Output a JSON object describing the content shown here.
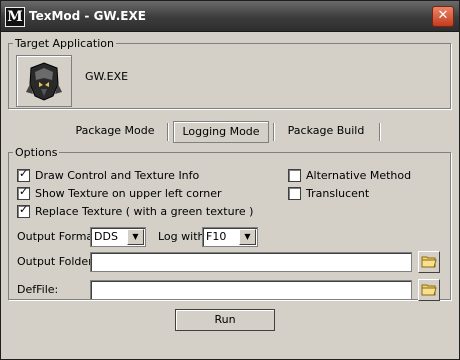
{
  "window": {
    "title": "TexMod - GW.EXE",
    "icon_glyph": "M",
    "close_glyph": "✕"
  },
  "target": {
    "legend": "Target Application",
    "exe_name": "GW.EXE",
    "exe_icon": "helmet-icon"
  },
  "tabs": [
    {
      "label": "Package Mode",
      "active": false
    },
    {
      "label": "Logging Mode",
      "active": true
    },
    {
      "label": "Package Build",
      "active": false
    }
  ],
  "options": {
    "legend": "Options",
    "draw_control": {
      "label": "Draw Control and Texture Info",
      "checked": true
    },
    "show_texture": {
      "label": "Show Texture on upper left corner",
      "checked": true
    },
    "replace_texture": {
      "label": "Replace Texture ( with a green texture )",
      "checked": true
    },
    "alternative_method": {
      "label": "Alternative Method",
      "checked": false
    },
    "translucent": {
      "label": "Translucent",
      "checked": false
    },
    "output_format_label": "Output Format:",
    "output_format_value": "DDS",
    "log_with_label": "Log with",
    "log_with_value": "F10",
    "output_folder_label": "Output Folder:",
    "output_folder_value": "",
    "deffile_label": "DefFile:",
    "deffile_value": ""
  },
  "run_label": "Run",
  "colors": {
    "folder": "#f5d36a",
    "titlebar": "#3c3c3c",
    "close": "#c43b1d"
  }
}
